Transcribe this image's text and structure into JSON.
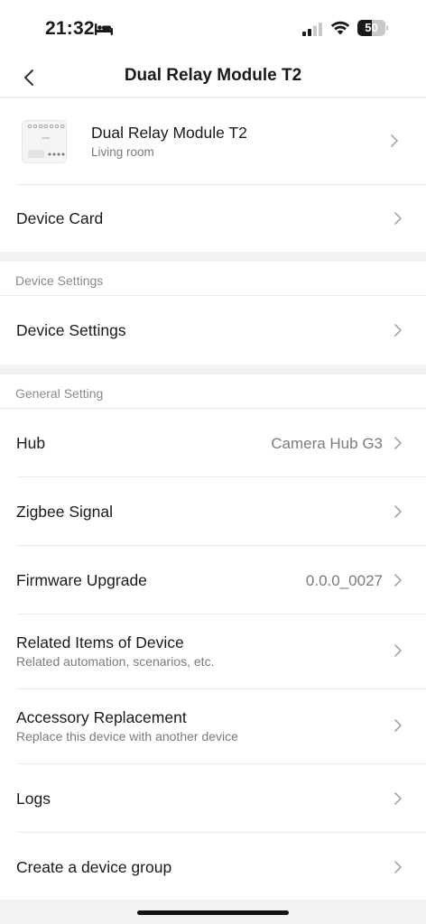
{
  "status_bar": {
    "time": "21:32",
    "battery_level": "50",
    "battery_fraction": 0.5,
    "icons": [
      "bed-icon",
      "cellular-signal-icon",
      "wifi-icon",
      "battery-icon"
    ]
  },
  "nav": {
    "title": "Dual Relay Module T2",
    "back_icon": "chevron-left-icon"
  },
  "device": {
    "name": "Dual Relay Module T2",
    "room": "Living room",
    "image_icon": "relay-module-image"
  },
  "items": {
    "device_card": "Device Card",
    "device_settings_section": "Device Settings",
    "device_settings": "Device Settings",
    "general_section": "General Setting",
    "hub_label": "Hub",
    "hub_value": "Camera Hub G3",
    "zigbee": "Zigbee Signal",
    "firmware_label": "Firmware Upgrade",
    "firmware_value": "0.0.0_0027",
    "related_title": "Related Items of Device",
    "related_sub": "Related automation, scenarios, etc.",
    "accessory_title": "Accessory Replacement",
    "accessory_sub": "Replace this device with another device",
    "logs": "Logs",
    "device_group": "Create a device group"
  },
  "colors": {
    "background": "#f2f2f2",
    "card": "#ffffff",
    "text_primary": "#1a1a1a",
    "text_secondary": "#7b7b7b",
    "chevron": "#a6a6a6"
  }
}
